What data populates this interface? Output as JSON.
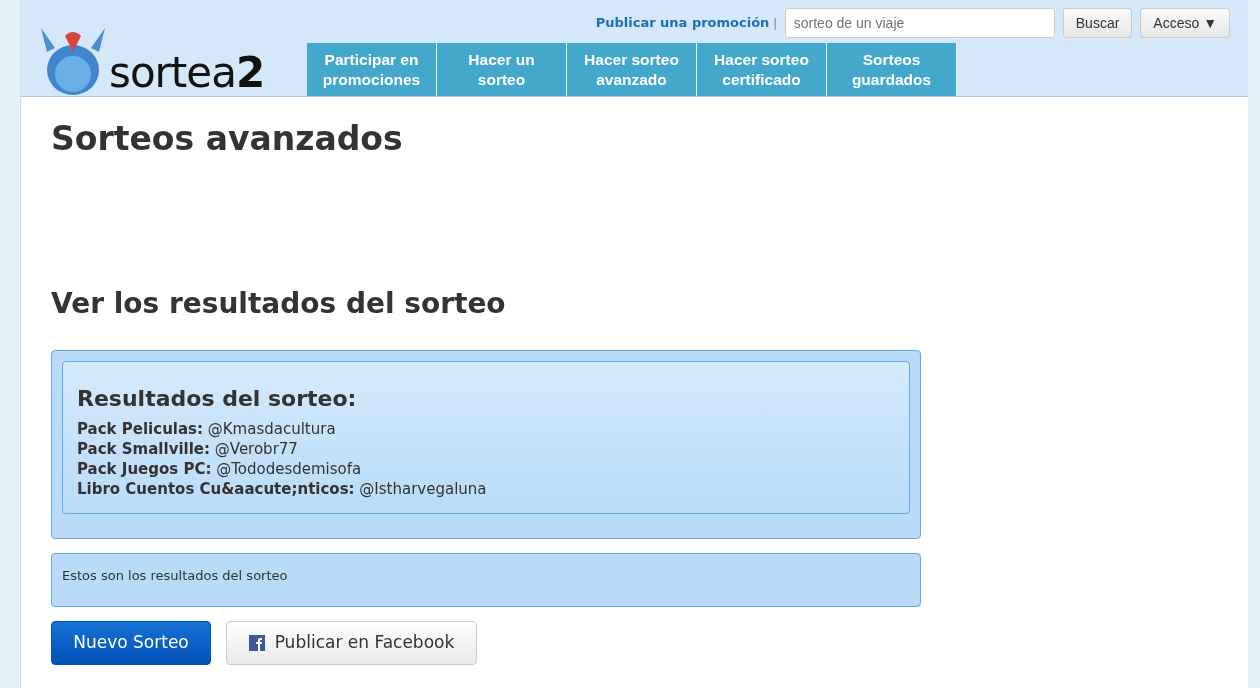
{
  "header": {
    "logo_text": "sortea**2**",
    "publish_link": "Publicar una promoción",
    "separator": "|",
    "search": {
      "placeholder": "sorteo de un viaje"
    },
    "search_button": "Buscar",
    "access_button": "Acceso ▼"
  },
  "nav": [
    {
      "label": "Participar en promociones"
    },
    {
      "label": "Hacer un sorteo"
    },
    {
      "label": "Hacer sorteo avanzado"
    },
    {
      "label": "Hacer sorteo certificado"
    },
    {
      "label": "Sorteos guardados"
    }
  ],
  "page_title": "Sorteos avanzados",
  "section_title": "Ver los resultados del sorteo",
  "results": {
    "title": "Resultados del sorteo:",
    "lines": [
      "**Pack Peliculas:** @Kmasdacultura",
      "**Pack Smallville:** @Verobr77",
      "**Pack Juegos PC:** @Tododesdemisofa",
      "**Libro Cuentos Cu&aacute;nticos:** @Istharvegaluna"
    ]
  },
  "message": "Estos son los resultados del sorteo",
  "buttons": [
    {
      "kind": "primary",
      "label": "Nuevo Sorteo"
    },
    {
      "kind": "facebook",
      "label": "Publicar en Facebook"
    }
  ]
}
